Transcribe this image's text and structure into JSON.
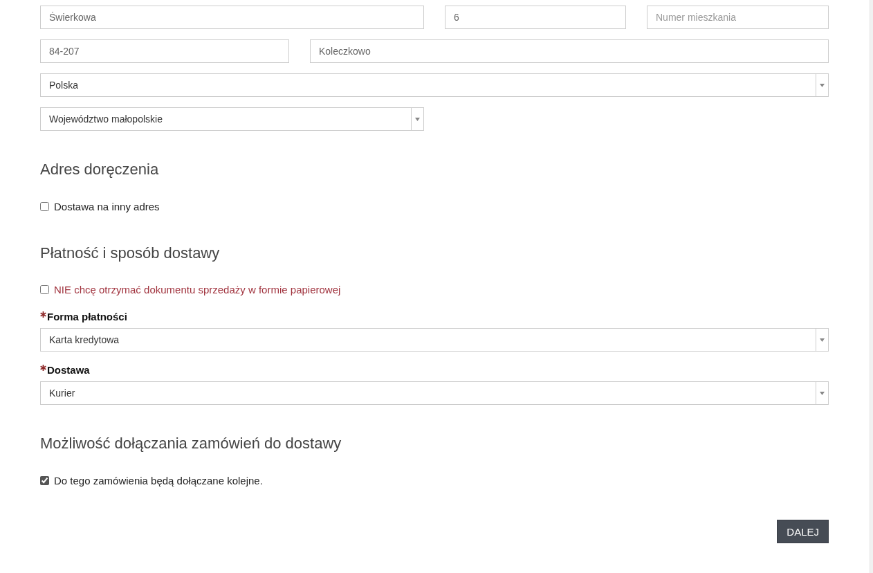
{
  "address_rows": [
    [
      {
        "kind": "input",
        "value": "Świerkowa"
      },
      {
        "kind": "input",
        "value": "6"
      },
      {
        "kind": "input",
        "placeholder": "Numer mieszkania"
      }
    ],
    [
      {
        "kind": "input",
        "value": "84-207"
      },
      {
        "kind": "input",
        "value": "Koleczkowo"
      }
    ],
    [
      {
        "kind": "select",
        "value": "Polska"
      }
    ],
    [
      {
        "kind": "select",
        "value": "Województwo małopolskie"
      }
    ]
  ],
  "delivery_address": {
    "heading": "Adres doręczenia",
    "checkbox": {
      "label": "Dostawa na inny adres",
      "checked": false
    }
  },
  "payment": {
    "heading": "Płatność i sposób dostawy",
    "paper_document_checkbox": {
      "label": "NIE chcę otrzymać dokumentu sprzedaży w formie papierowej",
      "checked": false
    },
    "fields": [
      {
        "label": "Forma płatności",
        "required": true,
        "value": "Karta kredytowa"
      },
      {
        "label": "Dostawa",
        "required": true,
        "value": "Kurier"
      }
    ]
  },
  "order_joining": {
    "heading": "Możliwość dołączania zamówień do dostawy",
    "checkbox": {
      "label": "Do tego zamówienia będą dołączane kolejne.",
      "checked": true
    }
  },
  "next_button": "DALEJ"
}
